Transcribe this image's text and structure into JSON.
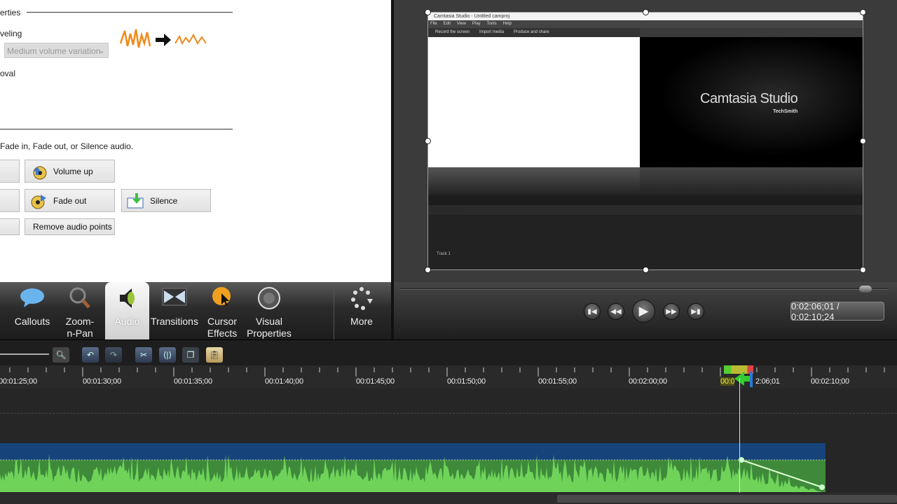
{
  "properties": {
    "section_title": "erties",
    "leveling_label": "veling",
    "leveling_select": "Medium volume variation",
    "noise_label": "oval",
    "instructions": "Fade in, Fade out, or Silence audio.",
    "buttons": {
      "volume_up": "Volume up",
      "fade_out": "Fade out",
      "silence": "Silence",
      "remove_points": "Remove audio points"
    }
  },
  "preview": {
    "window_title": "Camtasia Studio - Untitled camproj",
    "menu": [
      "File",
      "Edit",
      "View",
      "Play",
      "Tools",
      "Help"
    ],
    "toolbar": [
      "Record the screen",
      "Import media",
      "Produce and share"
    ],
    "splash_title": "Camtasia Studio",
    "splash_brand": "TechSmith",
    "track_label": "Track 1"
  },
  "tabs": [
    {
      "label": "Callouts",
      "icon": "callout-icon"
    },
    {
      "label": "Zoom-n-Pan",
      "icon": "magnifier-icon"
    },
    {
      "label": "Audio",
      "icon": "speaker-icon",
      "selected": true
    },
    {
      "label": "Transitions",
      "icon": "transitions-icon"
    },
    {
      "label": "Cursor Effects",
      "icon": "cursor-effects-icon"
    },
    {
      "label": "Visual Properties",
      "icon": "visual-properties-icon"
    },
    {
      "label": "More",
      "icon": "more-icon"
    }
  ],
  "player": {
    "time": "0:02:06;01 / 0:02:10;24",
    "scrub_position": 0.96
  },
  "timeline": {
    "ruler": [
      "00:01:25;00",
      "00:01:30;00",
      "00:01:35;00",
      "00:01:40;00",
      "00:01:45;00",
      "00:01:50;00",
      "00:01:55;00",
      "00:02:00;00",
      "00:02:10;00"
    ],
    "playhead_label": "00:02:06;01",
    "playhead_label_visible": "00:0",
    "playhead_label_tail": "2:06;01"
  },
  "colors": {
    "waveform": "#6fd35a",
    "clip": "#16437a",
    "playhead": "#e8e84a"
  }
}
